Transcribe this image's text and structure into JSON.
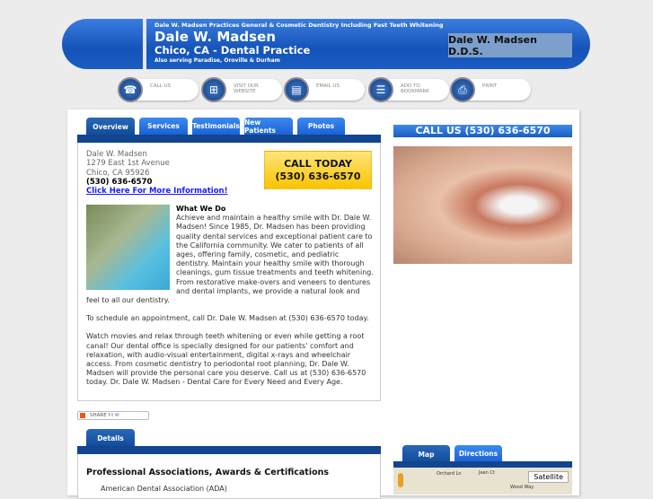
{
  "header": {
    "tagline": "Dale W. Madsen Practices General & Cosmetic Dentistry Including Fast Teeth Whitening",
    "name": "Dale W. Madsen",
    "location": "Chico, CA - Dental Practice",
    "also": "Also serving Paradise, Oroville & Durham",
    "badge": "Dale W. Madsen D.D.S."
  },
  "quick": [
    {
      "label": "CALL US",
      "icon": "phone-icon"
    },
    {
      "label": "VISIT OUR WEBSITE",
      "icon": "sitemap-icon"
    },
    {
      "label": "EMAIL US",
      "icon": "document-icon"
    },
    {
      "label": "ADD TO BOOKMARK",
      "icon": "bookmark-icon"
    },
    {
      "label": "PRINT",
      "icon": "printer-icon"
    }
  ],
  "tabs": [
    "Overview",
    "Services",
    "Testimonials",
    "New Patients",
    "Photos"
  ],
  "contact": {
    "name": "Dale W. Madsen",
    "street": "1279 East 1st Avenue",
    "city": "Chico, CA 95926",
    "phone": "(530) 636-6570",
    "link": "Click Here For More Information!"
  },
  "call_box": {
    "line1": "CALL TODAY",
    "line2": "(530) 636-6570"
  },
  "about": {
    "heading": "What We Do",
    "p1": "Achieve and maintain a healthy smile with Dr. Dale W. Madsen! Since 1985, Dr. Madsen has been providing quality dental services and exceptional patient care to the California community. We cater to patients of all ages, offering family, cosmetic, and pediatric dentistry. Maintain your healthy smile with thorough cleanings, gum tissue treatments and teeth whitening. From restorative make-overs and veneers to dentures and dental implants, we provide a natural look and feel to all our dentistry.",
    "p2": "To schedule an appointment, call Dr. Dale W. Madsen at (530) 636-6570 today.",
    "p3": "Watch movies and relax through teeth whitening or even while getting a root canal! Our dental office is specially designed for our patients' comfort and relaxation, with audio-visual entertainment, digital x-rays and wheelchair access. From cosmetic dentistry to periodontal root planning, Dr. Dale W. Madsen will provide the personal care you deserve. Call us at (530) 636-6570 today. Dr. Dale W. Madsen - Dental Care for Every Need and Every Age."
  },
  "share": "SHARE",
  "details_tab": "Details",
  "associations": {
    "heading": "Professional Associations, Awards & Certifications",
    "items": [
      "American Dental Association (ADA)"
    ]
  },
  "right": {
    "call_us": "CALL US (530) 636-6570",
    "map_tabs": [
      "Map",
      "Directions"
    ],
    "map_button": "Satellite",
    "streets": [
      "Orchard Ln",
      "Jean Ct",
      "Wood Way"
    ]
  }
}
